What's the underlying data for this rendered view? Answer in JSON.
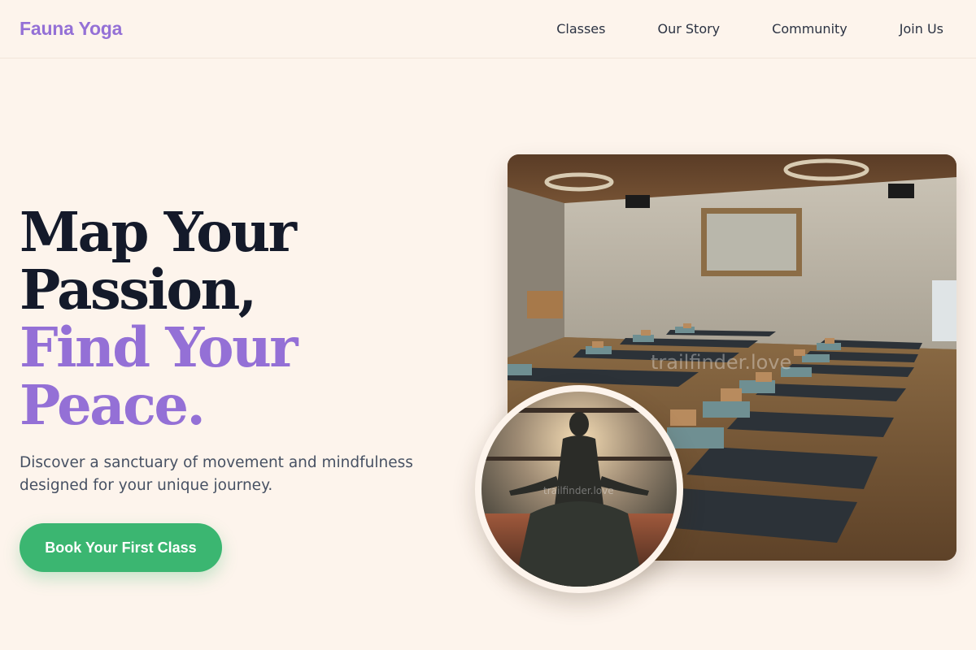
{
  "brand": {
    "name": "Fauna Yoga",
    "accent_color": "#9470d6",
    "cta_color": "#3bb671",
    "background": "#fdf4ec"
  },
  "nav": {
    "links": [
      "Classes",
      "Our Story",
      "Community",
      "Join Us"
    ]
  },
  "hero": {
    "headline_line1": "Map Your",
    "headline_line2": "Passion,",
    "headline_accent": "Find Your Peace.",
    "subtext": "Discover a sanctuary of movement and mindfulness designed for your unique journey.",
    "cta_label": "Book Your First Class"
  },
  "images": {
    "main_watermark": "trailfinder.love",
    "round_watermark": "trailfinder.love"
  }
}
